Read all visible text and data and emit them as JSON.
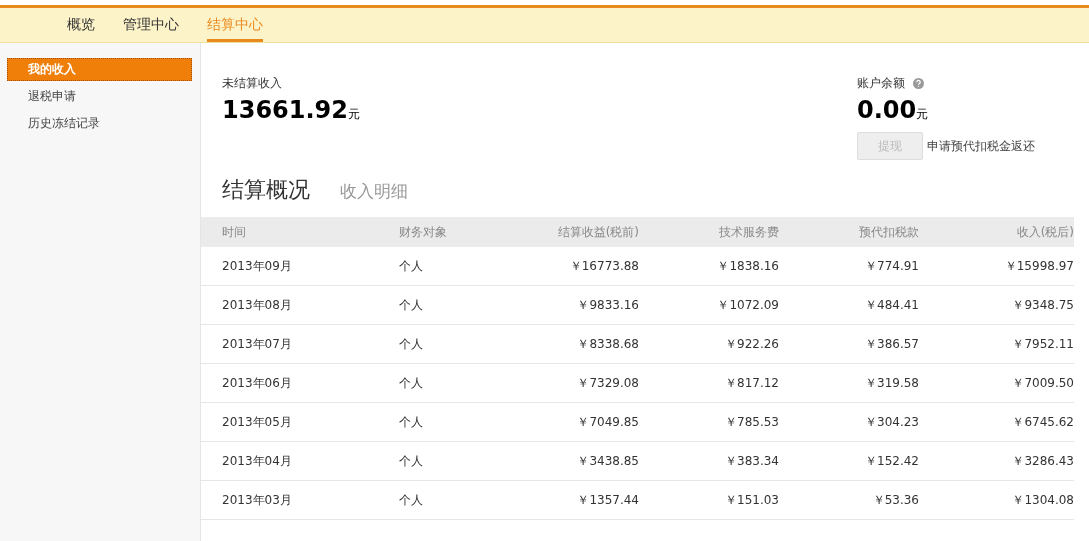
{
  "nav": [
    {
      "label": "概览",
      "selected": false
    },
    {
      "label": "管理中心",
      "selected": false
    },
    {
      "label": "结算中心",
      "selected": true
    }
  ],
  "sidebar": {
    "items": [
      {
        "label": "我的收入",
        "selected": true
      },
      {
        "label": "退税申请",
        "selected": false
      },
      {
        "label": "历史冻结记录",
        "selected": false
      }
    ]
  },
  "unsettled": {
    "label": "未结算收入",
    "amount": "13661.92",
    "unit": "元"
  },
  "balance": {
    "label": "账户余额",
    "amount": "0.00",
    "unit": "元",
    "withdraw_button": {
      "label": "提现",
      "disabled": true
    },
    "refund_link": "申请预代扣税金返还"
  },
  "section_tabs": [
    {
      "label": "结算概况",
      "selected": true
    },
    {
      "label": "收入明细",
      "selected": false
    }
  ],
  "table": {
    "columns": [
      "时间",
      "财务对象",
      "结算收益(税前)",
      "技术服务费",
      "预代扣税款",
      "收入(税后)"
    ],
    "rows": [
      [
        "2013年09月",
        "个人",
        "￥16773.88",
        "￥1838.16",
        "￥774.91",
        "￥15998.97"
      ],
      [
        "2013年08月",
        "个人",
        "￥9833.16",
        "￥1072.09",
        "￥484.41",
        "￥9348.75"
      ],
      [
        "2013年07月",
        "个人",
        "￥8338.68",
        "￥922.26",
        "￥386.57",
        "￥7952.11"
      ],
      [
        "2013年06月",
        "个人",
        "￥7329.08",
        "￥817.12",
        "￥319.58",
        "￥7009.50"
      ],
      [
        "2013年05月",
        "个人",
        "￥7049.85",
        "￥785.53",
        "￥304.23",
        "￥6745.62"
      ],
      [
        "2013年04月",
        "个人",
        "￥3438.85",
        "￥383.34",
        "￥152.42",
        "￥3286.43"
      ],
      [
        "2013年03月",
        "个人",
        "￥1357.44",
        "￥151.03",
        "￥53.36",
        "￥1304.08"
      ]
    ]
  }
}
